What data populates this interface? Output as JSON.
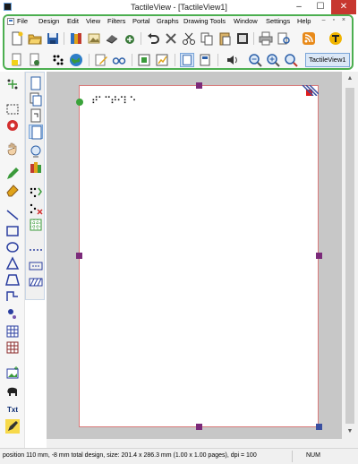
{
  "window": {
    "title": "TactileView - [TactileView1]",
    "min_glyph": "–",
    "max_glyph": "☐",
    "close_glyph": "✕"
  },
  "menu": {
    "items": [
      "File",
      "Design",
      "Edit",
      "View",
      "Filters",
      "Portal",
      "Graphs",
      "Drawing Tools",
      "Window",
      "Settings",
      "Help"
    ],
    "mdi_controls": "– ▫ ×"
  },
  "toolbar1": {
    "icons": [
      "new-document-icon",
      "open-folder-icon",
      "save-icon",
      "library-icon",
      "gallery-icon",
      "scan-icon",
      "export-icon",
      "undo-icon",
      "delete-icon",
      "cut-icon",
      "copy-icon",
      "paste-icon",
      "clipboard-icon",
      "print-icon",
      "print-preview-icon",
      "rss-feed-icon",
      "portal-icon"
    ]
  },
  "toolbar2": {
    "icons": [
      "highlight-icon",
      "page-settings-icon",
      "braille-dots-icon",
      "globe-icon",
      "edit-text-icon",
      "glasses-icon",
      "image-tool-icon",
      "graph-tool-icon",
      "page-view-icon",
      "page-single-icon",
      "audio-icon",
      "zoom-out-icon",
      "zoom-in-icon",
      "zoom-fit-icon"
    ],
    "tab_label": "TactileView1"
  },
  "document": {
    "braille_text": "⠞⠁⠉⠞⠊⠇⠑"
  },
  "status": {
    "message": "position 110 mm, -8 mm total design, size: 201.4 x 286.3 mm (1.00 x 1.00 pages), dpi = 100",
    "indicator": "NUM"
  },
  "left_toolbar": {
    "text_tool_label": "Txt"
  },
  "colors": {
    "frame_highlight": "#4caf50",
    "handle": "#7b2a7a",
    "accent_blue": "#3b78c7",
    "close_red": "#c7372f"
  }
}
